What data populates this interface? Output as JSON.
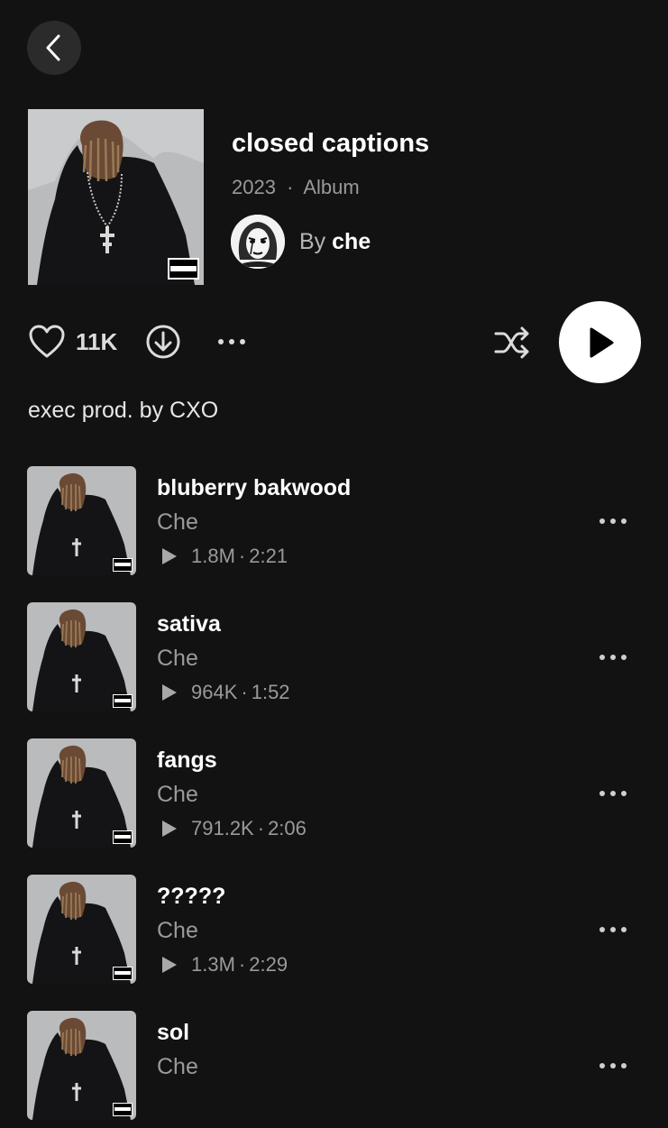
{
  "header": {
    "back_icon": "chevron-left-icon"
  },
  "album": {
    "title": "closed captions",
    "year": "2023",
    "separator": "·",
    "type": "Album",
    "by_prefix": "By",
    "artist": "che",
    "parental_advisory_label": "PARENTAL ADVISORY EXPLICIT CONTENT"
  },
  "actions": {
    "likes": "11K",
    "heart_icon": "heart-icon",
    "download_icon": "download-icon",
    "more_icon": "more-horizontal-icon",
    "shuffle_icon": "shuffle-icon",
    "play_icon": "play-icon"
  },
  "description": "exec prod. by CXO",
  "tracks": [
    {
      "title": "bluberry bakwood",
      "artist": "Che",
      "plays": "1.8M",
      "duration": "2:21"
    },
    {
      "title": "sativa",
      "artist": "Che",
      "plays": "964K",
      "duration": "1:52"
    },
    {
      "title": "fangs",
      "artist": "Che",
      "plays": "791.2K",
      "duration": "2:06"
    },
    {
      "title": "?????",
      "artist": "Che",
      "plays": "1.3M",
      "duration": "2:29"
    },
    {
      "title": "sol",
      "artist": "Che",
      "plays": "",
      "duration": ""
    }
  ],
  "colors": {
    "background": "#121212",
    "secondary_text": "#9a9a9a",
    "play_button": "#ffffff"
  }
}
